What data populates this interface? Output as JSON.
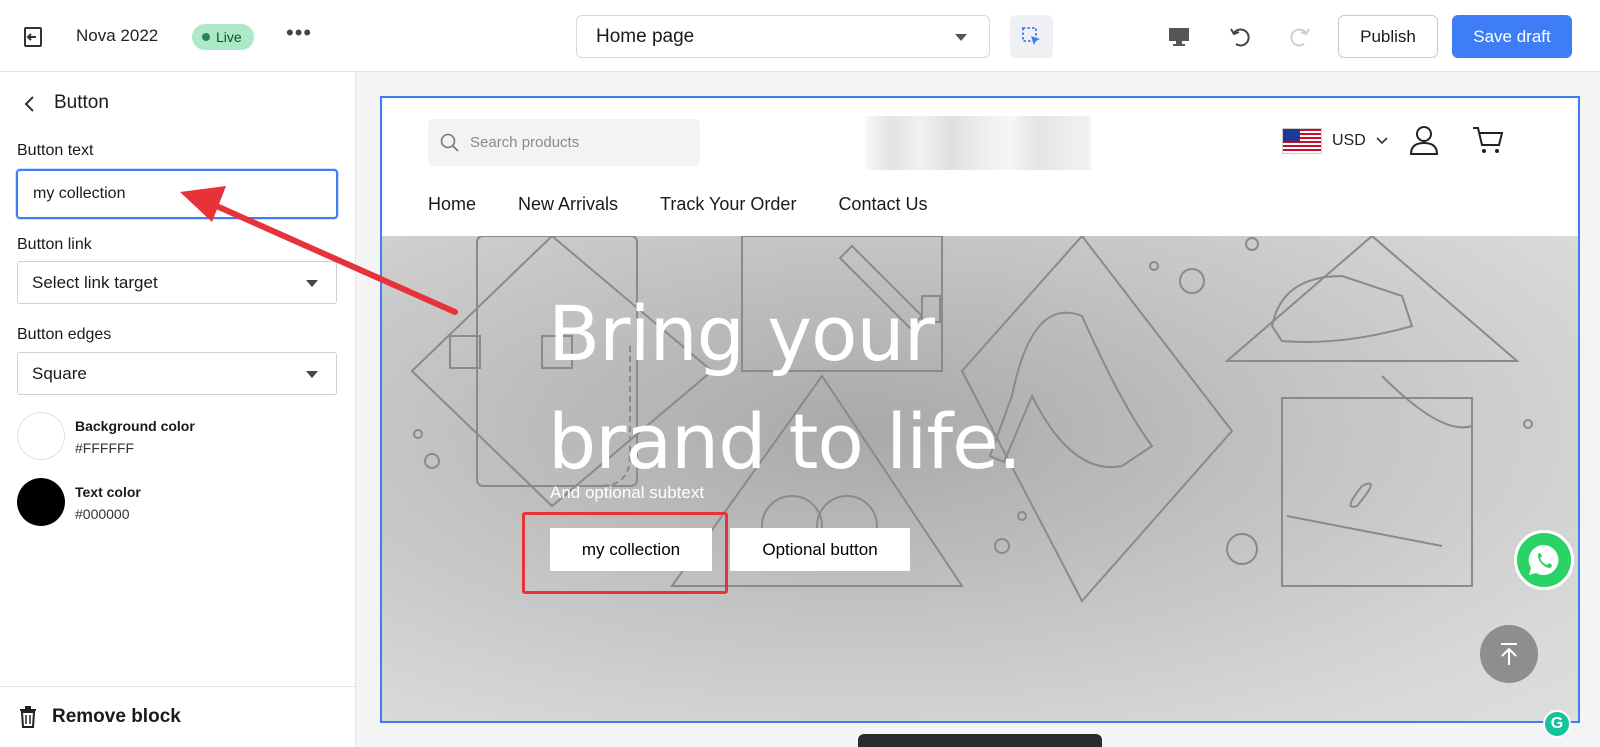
{
  "topbar": {
    "theme_name": "Nova 2022",
    "status_badge": "Live",
    "page_selector": "Home page",
    "publish_label": "Publish",
    "save_label": "Save draft"
  },
  "sidebar": {
    "title": "Button",
    "fields": {
      "button_text_label": "Button text",
      "button_text_value": "my collection",
      "button_link_label": "Button link",
      "button_link_value": "Select link target",
      "button_edges_label": "Button edges",
      "button_edges_value": "Square"
    },
    "colors": [
      {
        "name": "Background color",
        "value": "#FFFFFF"
      },
      {
        "name": "Text color",
        "value": "#000000"
      }
    ],
    "footer_action": "Remove block"
  },
  "preview": {
    "search_placeholder": "Search products",
    "currency": "USD",
    "nav": [
      "Home",
      "New Arrivals",
      "Track Your Order",
      "Contact Us"
    ],
    "hero": {
      "headline_line1": "Bring your",
      "headline_line2": "brand to life.",
      "subtext": "And optional subtext",
      "primary_button": "my collection",
      "secondary_button": "Optional button"
    }
  },
  "colors": {
    "accent": "#3f7df6",
    "live_badge": "#aee9c7",
    "annotation_red": "#e8323a",
    "whatsapp": "#2bd366"
  },
  "icons": [
    "exit-icon",
    "more-icon",
    "inspect-icon",
    "desktop-icon",
    "undo-icon",
    "redo-icon",
    "back-icon",
    "trash-icon",
    "search-icon",
    "flag-icon",
    "chevron-down-icon",
    "user-icon",
    "cart-icon",
    "whatsapp-icon",
    "arrow-up-icon"
  ]
}
